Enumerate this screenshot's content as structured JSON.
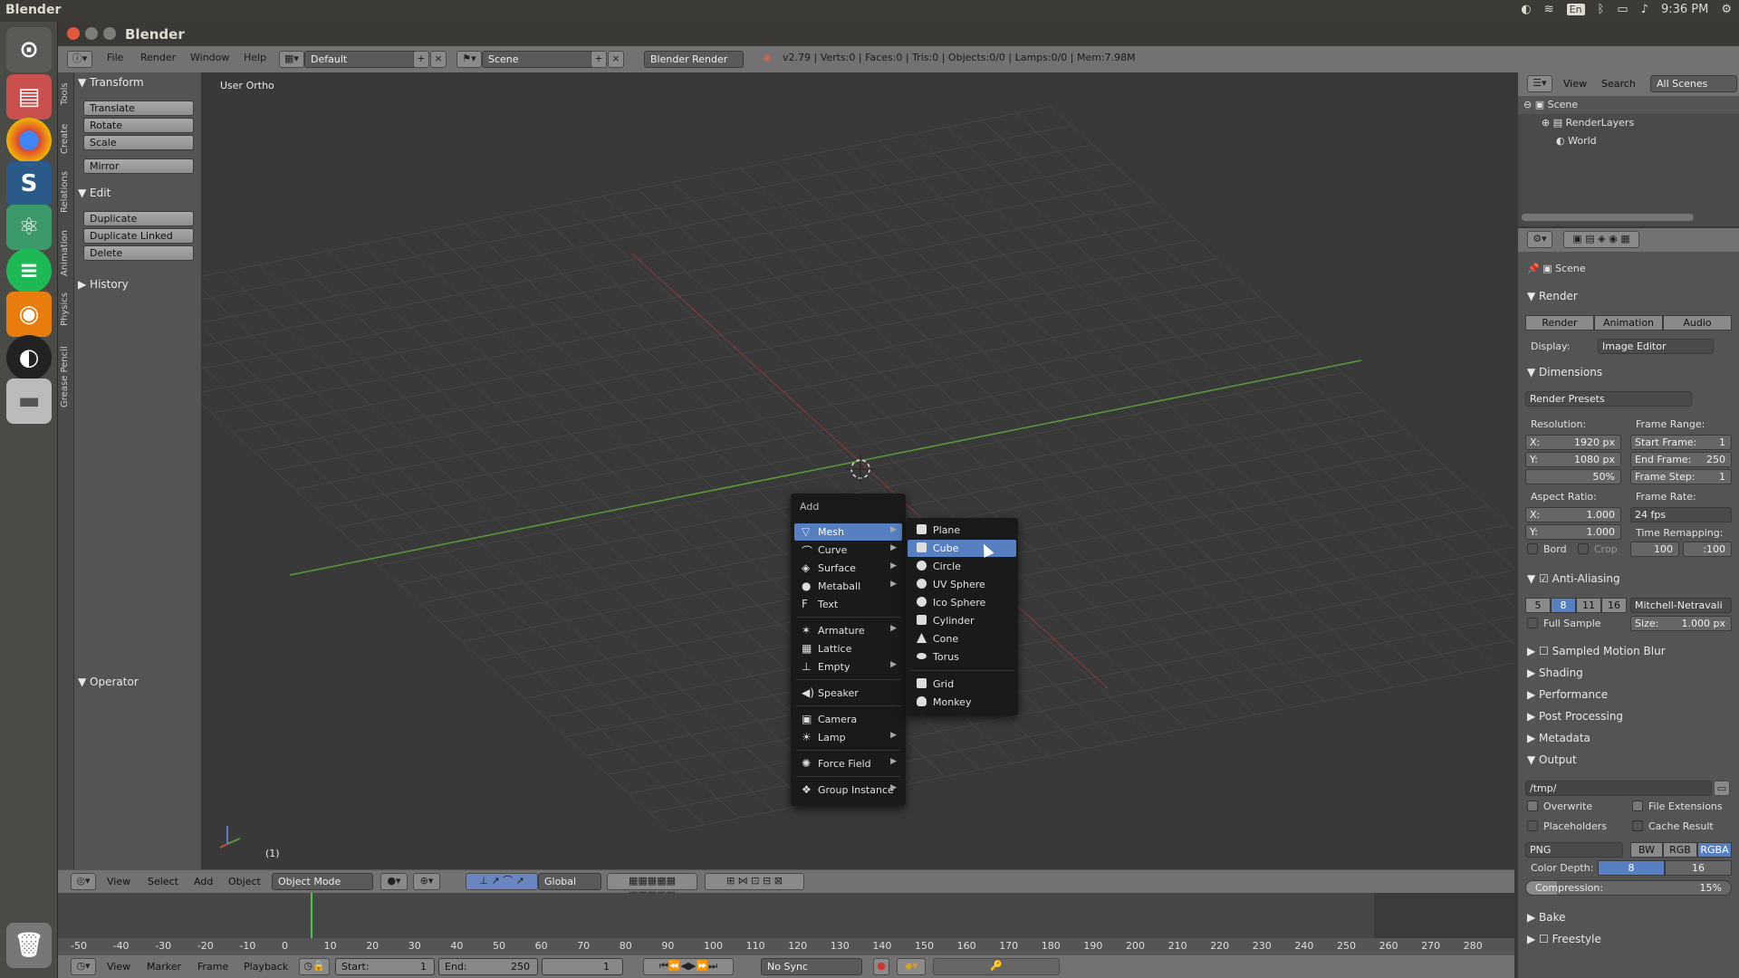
{
  "os": {
    "app_name": "Blender",
    "time": "9:36 PM",
    "lang": "En"
  },
  "window": {
    "title": "Blender"
  },
  "info_header": {
    "menus": [
      "File",
      "Render",
      "Window",
      "Help"
    ],
    "layout": "Default",
    "scene": "Scene",
    "engine": "Blender Render",
    "stats": "v2.79 | Verts:0 | Faces:0 | Tris:0 | Objects:0/0 | Lamps:0/0 | Mem:7.98M"
  },
  "tool_tabs": [
    "Tools",
    "Create",
    "Relations",
    "Animation",
    "Physics",
    "Grease Pencil"
  ],
  "tool_shelf": {
    "transform_title": "Transform",
    "transform_buttons": [
      "Translate",
      "Rotate",
      "Scale"
    ],
    "mirror": "Mirror",
    "edit_title": "Edit",
    "edit_buttons": [
      "Duplicate",
      "Duplicate Linked",
      "Delete"
    ],
    "history_title": "History",
    "operator_title": "Operator"
  },
  "viewport": {
    "label": "User Ortho",
    "frame": "(1)"
  },
  "add_menu": {
    "title": "Add",
    "items": [
      "Mesh",
      "Curve",
      "Surface",
      "Metaball",
      "Text",
      "Armature",
      "Lattice",
      "Empty",
      "Speaker",
      "Camera",
      "Lamp",
      "Force Field",
      "Group Instance"
    ],
    "active": "Mesh"
  },
  "mesh_submenu": {
    "items": [
      "Plane",
      "Cube",
      "Circle",
      "UV Sphere",
      "Ico Sphere",
      "Cylinder",
      "Cone",
      "Torus",
      "Grid",
      "Monkey"
    ],
    "active": "Cube"
  },
  "view3d_header": {
    "menus": [
      "View",
      "Select",
      "Add",
      "Object"
    ],
    "mode": "Object Mode",
    "orientation": "Global"
  },
  "timeline": {
    "ticks": [
      "-50",
      "-40",
      "-30",
      "-20",
      "-10",
      "0",
      "10",
      "20",
      "30",
      "40",
      "50",
      "60",
      "70",
      "80",
      "90",
      "100",
      "110",
      "120",
      "130",
      "140",
      "150",
      "160",
      "170",
      "180",
      "190",
      "200",
      "210",
      "220",
      "230",
      "240",
      "250",
      "260",
      "270",
      "280"
    ],
    "menus": [
      "View",
      "Marker",
      "Frame",
      "Playback"
    ],
    "start_label": "Start:",
    "start": "1",
    "end_label": "End:",
    "end": "250",
    "current": "1",
    "sync": "No Sync"
  },
  "outliner": {
    "menus": [
      "View",
      "Search"
    ],
    "filter": "All Scenes",
    "rows": [
      "Scene",
      "RenderLayers",
      "World"
    ]
  },
  "properties": {
    "context": "Scene",
    "render_title": "Render",
    "render_buttons": [
      "Render",
      "Animation",
      "Audio"
    ],
    "display_label": "Display:",
    "display_value": "Image Editor",
    "dimensions_title": "Dimensions",
    "presets": "Render Presets",
    "resolution_label": "Resolution:",
    "res_x_label": "X:",
    "res_x": "1920 px",
    "res_y_label": "Y:",
    "res_y": "1080 px",
    "res_pct": "50%",
    "frame_range_label": "Frame Range:",
    "start_frame_label": "Start Frame:",
    "start_frame": "1",
    "end_frame_label": "End Frame:",
    "end_frame": "250",
    "frame_step_label": "Frame Step:",
    "frame_step": "1",
    "aspect_label": "Aspect Ratio:",
    "aspect_x_label": "X:",
    "aspect_x": "1.000",
    "aspect_y_label": "Y:",
    "aspect_y": "1.000",
    "frame_rate_label": "Frame Rate:",
    "fps": "24 fps",
    "time_remap_label": "Time Remapping:",
    "remap_old": "100",
    "remap_new": ":100",
    "bord": "Bord",
    "crop": "Crop",
    "aa_title": "Anti-Aliasing",
    "aa_samples": [
      "5",
      "8",
      "11",
      "16"
    ],
    "aa_active": "8",
    "aa_filter": "Mitchell-Netravali",
    "full_sample": "Full Sample",
    "size_label": "Size:",
    "size_value": "1.000 px",
    "collapsed": [
      "Sampled Motion Blur",
      "Shading",
      "Performance",
      "Post Processing",
      "Metadata"
    ],
    "output_title": "Output",
    "output_path": "/tmp/",
    "overwrite": "Overwrite",
    "file_ext": "File Extensions",
    "placeholders": "Placeholders",
    "cache_result": "Cache Result",
    "format": "PNG",
    "color_modes": [
      "BW",
      "RGB",
      "RGBA"
    ],
    "color_active": "RGBA",
    "color_depth_label": "Color Depth:",
    "depth_8": "8",
    "depth_16": "16",
    "compression_label": "Compression:",
    "compression_value": "15%",
    "bottom_sections": [
      "Bake",
      "Freestyle"
    ]
  },
  "colors": {
    "accent": "#5680c2",
    "x_axis": "#8a3a3a",
    "y_axis": "#5a9a3a"
  }
}
